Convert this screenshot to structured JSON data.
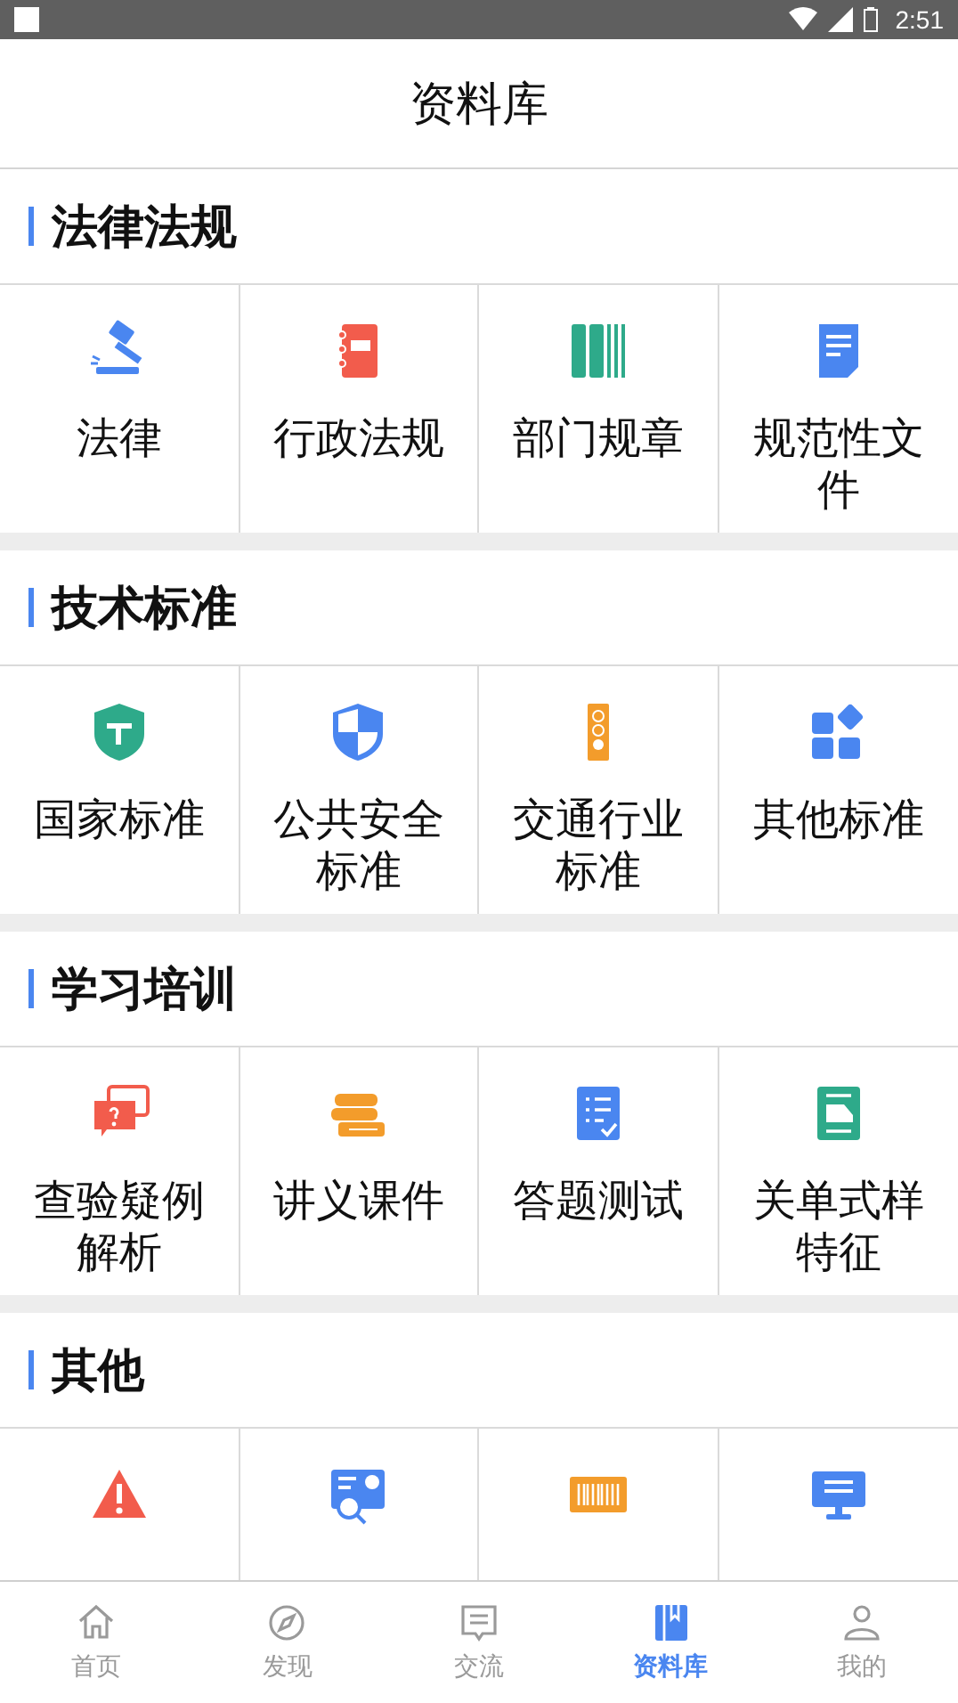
{
  "status_bar": {
    "time": "2:51"
  },
  "header": {
    "title": "资料库"
  },
  "sections": [
    {
      "title": "法律法规",
      "items": [
        {
          "label": "法律"
        },
        {
          "label": "行政法规"
        },
        {
          "label": "部门规章"
        },
        {
          "label": "规范性文件"
        }
      ]
    },
    {
      "title": "技术标准",
      "items": [
        {
          "label": "国家标准"
        },
        {
          "label": "公共安全标准"
        },
        {
          "label": "交通行业标准"
        },
        {
          "label": "其他标准"
        }
      ]
    },
    {
      "title": "学习培训",
      "items": [
        {
          "label": "查验疑例解析"
        },
        {
          "label": "讲义课件"
        },
        {
          "label": "答题测试"
        },
        {
          "label": "关单式样特征"
        }
      ]
    },
    {
      "title": "其他"
    }
  ],
  "tab_bar": [
    {
      "label": "首页",
      "selected": false
    },
    {
      "label": "发现",
      "selected": false
    },
    {
      "label": "交流",
      "selected": false
    },
    {
      "label": "资料库",
      "selected": true
    },
    {
      "label": "我的",
      "selected": false
    }
  ]
}
